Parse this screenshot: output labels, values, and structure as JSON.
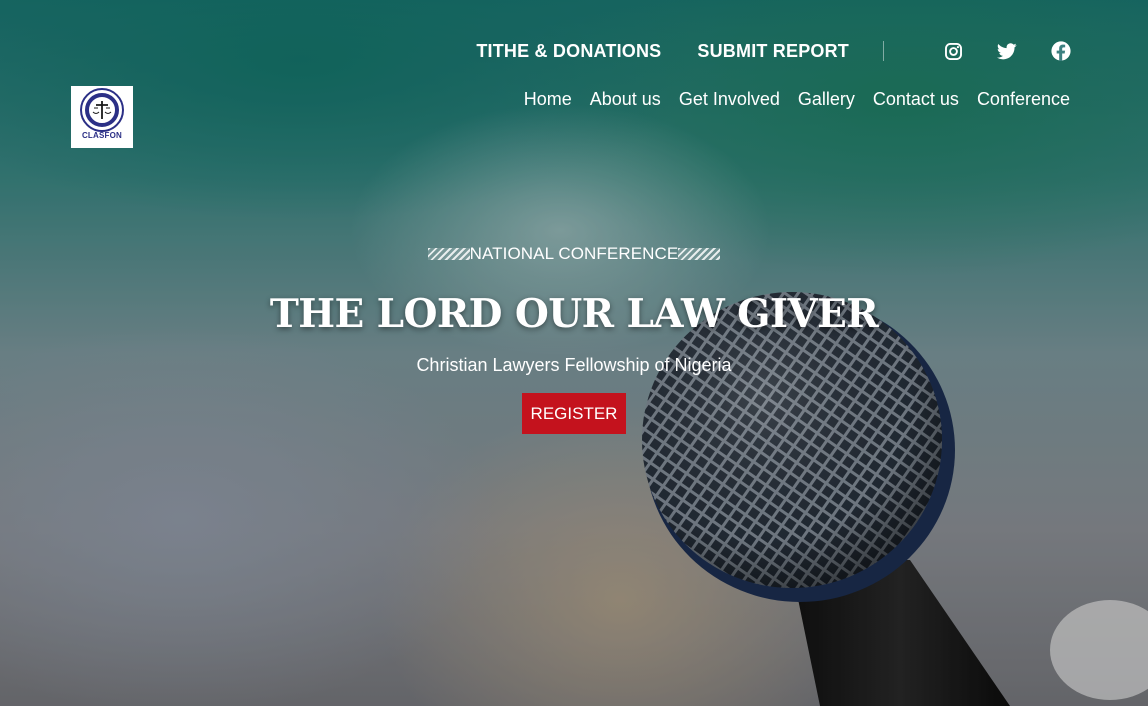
{
  "topbar": {
    "tithe_label": "TITHE & DONATIONS",
    "report_label": "SUBMIT REPORT",
    "socials": [
      "instagram-icon",
      "twitter-icon",
      "facebook-icon"
    ]
  },
  "logo": {
    "text": "CLASFON",
    "ring_text": "CHRISTIAN LAWYERS FELLOWSHIP OF NIGERIA"
  },
  "nav": {
    "items": [
      {
        "label": "Home"
      },
      {
        "label": "About us"
      },
      {
        "label": "Get Involved"
      },
      {
        "label": "Gallery"
      },
      {
        "label": "Contact us"
      },
      {
        "label": "Conference"
      }
    ]
  },
  "hero": {
    "eyebrow": "NATIONAL CONFERENCE",
    "headline": "THE LORD OUR LAW GIVER",
    "subtitle": "Christian Lawyers Fellowship of Nigeria",
    "cta_label": "REGISTER"
  },
  "colors": {
    "cta": "#c4121d",
    "logo_accent": "#2b2f86"
  }
}
